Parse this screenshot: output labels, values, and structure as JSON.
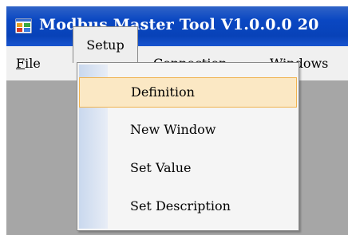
{
  "window": {
    "title": "Modbus Master Tool V1.0.0.0  20"
  },
  "menubar": {
    "items": [
      {
        "label": "File",
        "mnemonic": "F",
        "rest": "ile"
      },
      {
        "label": "Setup"
      },
      {
        "label": "Connection"
      },
      {
        "label": "Windows",
        "mnemonic": "W",
        "rest": "indows"
      }
    ]
  },
  "setup_menu": {
    "items": [
      {
        "label": "Definition",
        "highlighted": true
      },
      {
        "label": "New Window"
      },
      {
        "label": "Set Value"
      },
      {
        "label": "Set Description"
      }
    ]
  },
  "colors": {
    "titlebar": "#0a47c2",
    "highlight": "#fbe8c4",
    "highlight_border": "#f0b34f",
    "workspace": "#a6a6a6"
  }
}
